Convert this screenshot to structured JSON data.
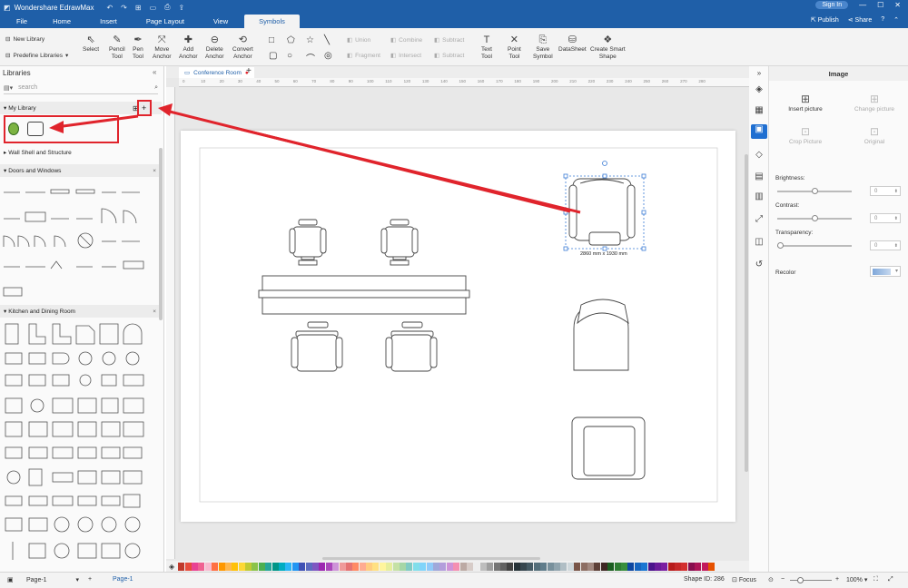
{
  "titlebar": {
    "app_name": "Wondershare EdrawMax",
    "sign_in": "Sign In"
  },
  "menu": {
    "items": [
      "File",
      "Home",
      "Insert",
      "Page Layout",
      "View",
      "Symbols"
    ],
    "active": "Symbols",
    "publish": "Publish",
    "share": "Share"
  },
  "ribbon": {
    "new_library": "New Library",
    "predefine_libraries": "Predefine Libraries",
    "select": "Select",
    "pencil_tool_1": "Pencil",
    "pencil_tool_2": "Tool",
    "pen_tool_1": "Pen",
    "pen_tool_2": "Tool",
    "move_anchor_1": "Move",
    "move_anchor_2": "Anchor",
    "add_anchor_1": "Add",
    "add_anchor_2": "Anchor",
    "delete_anchor_1": "Delete",
    "delete_anchor_2": "Anchor",
    "convert_anchor_1": "Convert",
    "convert_anchor_2": "Anchor",
    "union": "Union",
    "combine": "Combine",
    "subtract_1": "Subtract",
    "fragment": "Fragment",
    "intersect": "Intersect",
    "subtract_2": "Subtract",
    "text_tool_1": "Text",
    "text_tool_2": "Tool",
    "point_tool_1": "Point",
    "point_tool_2": "Tool",
    "save_symbol_1": "Save",
    "save_symbol_2": "Symbol",
    "datasheet": "DataSheet",
    "create_smart_shape_1": "Create Smart",
    "create_smart_shape_2": "Shape"
  },
  "libraries": {
    "title": "Libraries",
    "search_placeholder": "search",
    "sections": [
      "My Library",
      "Wall Shell and Structure",
      "Doors and Windows",
      "Kitchen and Dining Room"
    ]
  },
  "document": {
    "tab_name": "Conference Room",
    "selection_size": "2860 mm x 1930 mm"
  },
  "ruler_ticks": [
    "0",
    "10",
    "20",
    "30",
    "40",
    "50",
    "60",
    "70",
    "80",
    "90",
    "100",
    "110",
    "120",
    "130",
    "140",
    "150",
    "160",
    "170",
    "180",
    "190",
    "200",
    "210",
    "220",
    "230",
    "240",
    "250",
    "260",
    "270",
    "280"
  ],
  "right_panel": {
    "title": "Image",
    "insert_picture": "Insert picture",
    "change_picture": "Change picture",
    "crop_picture": "Crop Picture",
    "original": "Original",
    "brightness": "Brightness:",
    "contrast": "Contrast:",
    "transparency": "Transparency:",
    "recolor": "Recolor",
    "brightness_value": "0",
    "contrast_value": "0",
    "transparency_value": "0"
  },
  "palette": [
    "#c0392b",
    "#e74c3c",
    "#e84393",
    "#f06292",
    "#f8bbd0",
    "#ff7043",
    "#ff9800",
    "#ffb74d",
    "#ffc107",
    "#fdd835",
    "#c0ca33",
    "#8bc34a",
    "#4caf50",
    "#26a69a",
    "#009688",
    "#00acc1",
    "#29b6f6",
    "#2196f3",
    "#3f51b5",
    "#5c6bc0",
    "#7e57c2",
    "#9c27b0",
    "#ab47bc",
    "#ce93d8",
    "#ef9a9a",
    "#e57373",
    "#ff8a65",
    "#ffab91",
    "#ffcc80",
    "#ffe082",
    "#fff59d",
    "#e6ee9c",
    "#c5e1a5",
    "#a5d6a7",
    "#80cbc4",
    "#80deea",
    "#81d4fa",
    "#90caf9",
    "#9fa8da",
    "#b39ddb",
    "#ce93d8",
    "#f48fb1",
    "#bcaaa4",
    "#d7ccc8",
    "#eeeeee",
    "#bdbdbd",
    "#9e9e9e",
    "#757575",
    "#616161",
    "#424242",
    "#263238",
    "#37474f",
    "#455a64",
    "#546e7a",
    "#607d8b",
    "#78909c",
    "#90a4ae",
    "#b0bec5",
    "#cfd8dc",
    "#795548",
    "#8d6e63",
    "#a1887f",
    "#5d4037",
    "#3e2723",
    "#1b5e20",
    "#2e7d32",
    "#388e3c",
    "#0d47a1",
    "#1565c0",
    "#1976d2",
    "#4a148c",
    "#6a1b9a",
    "#7b1fa2",
    "#b71c1c",
    "#c62828",
    "#d32f2f",
    "#880e4f",
    "#ad1457",
    "#c2185b",
    "#e65100"
  ],
  "status": {
    "page_select": "Page-1",
    "page_tab": "Page-1",
    "shape_id": "Shape ID: 286",
    "focus": "Focus",
    "zoom": "100%"
  }
}
